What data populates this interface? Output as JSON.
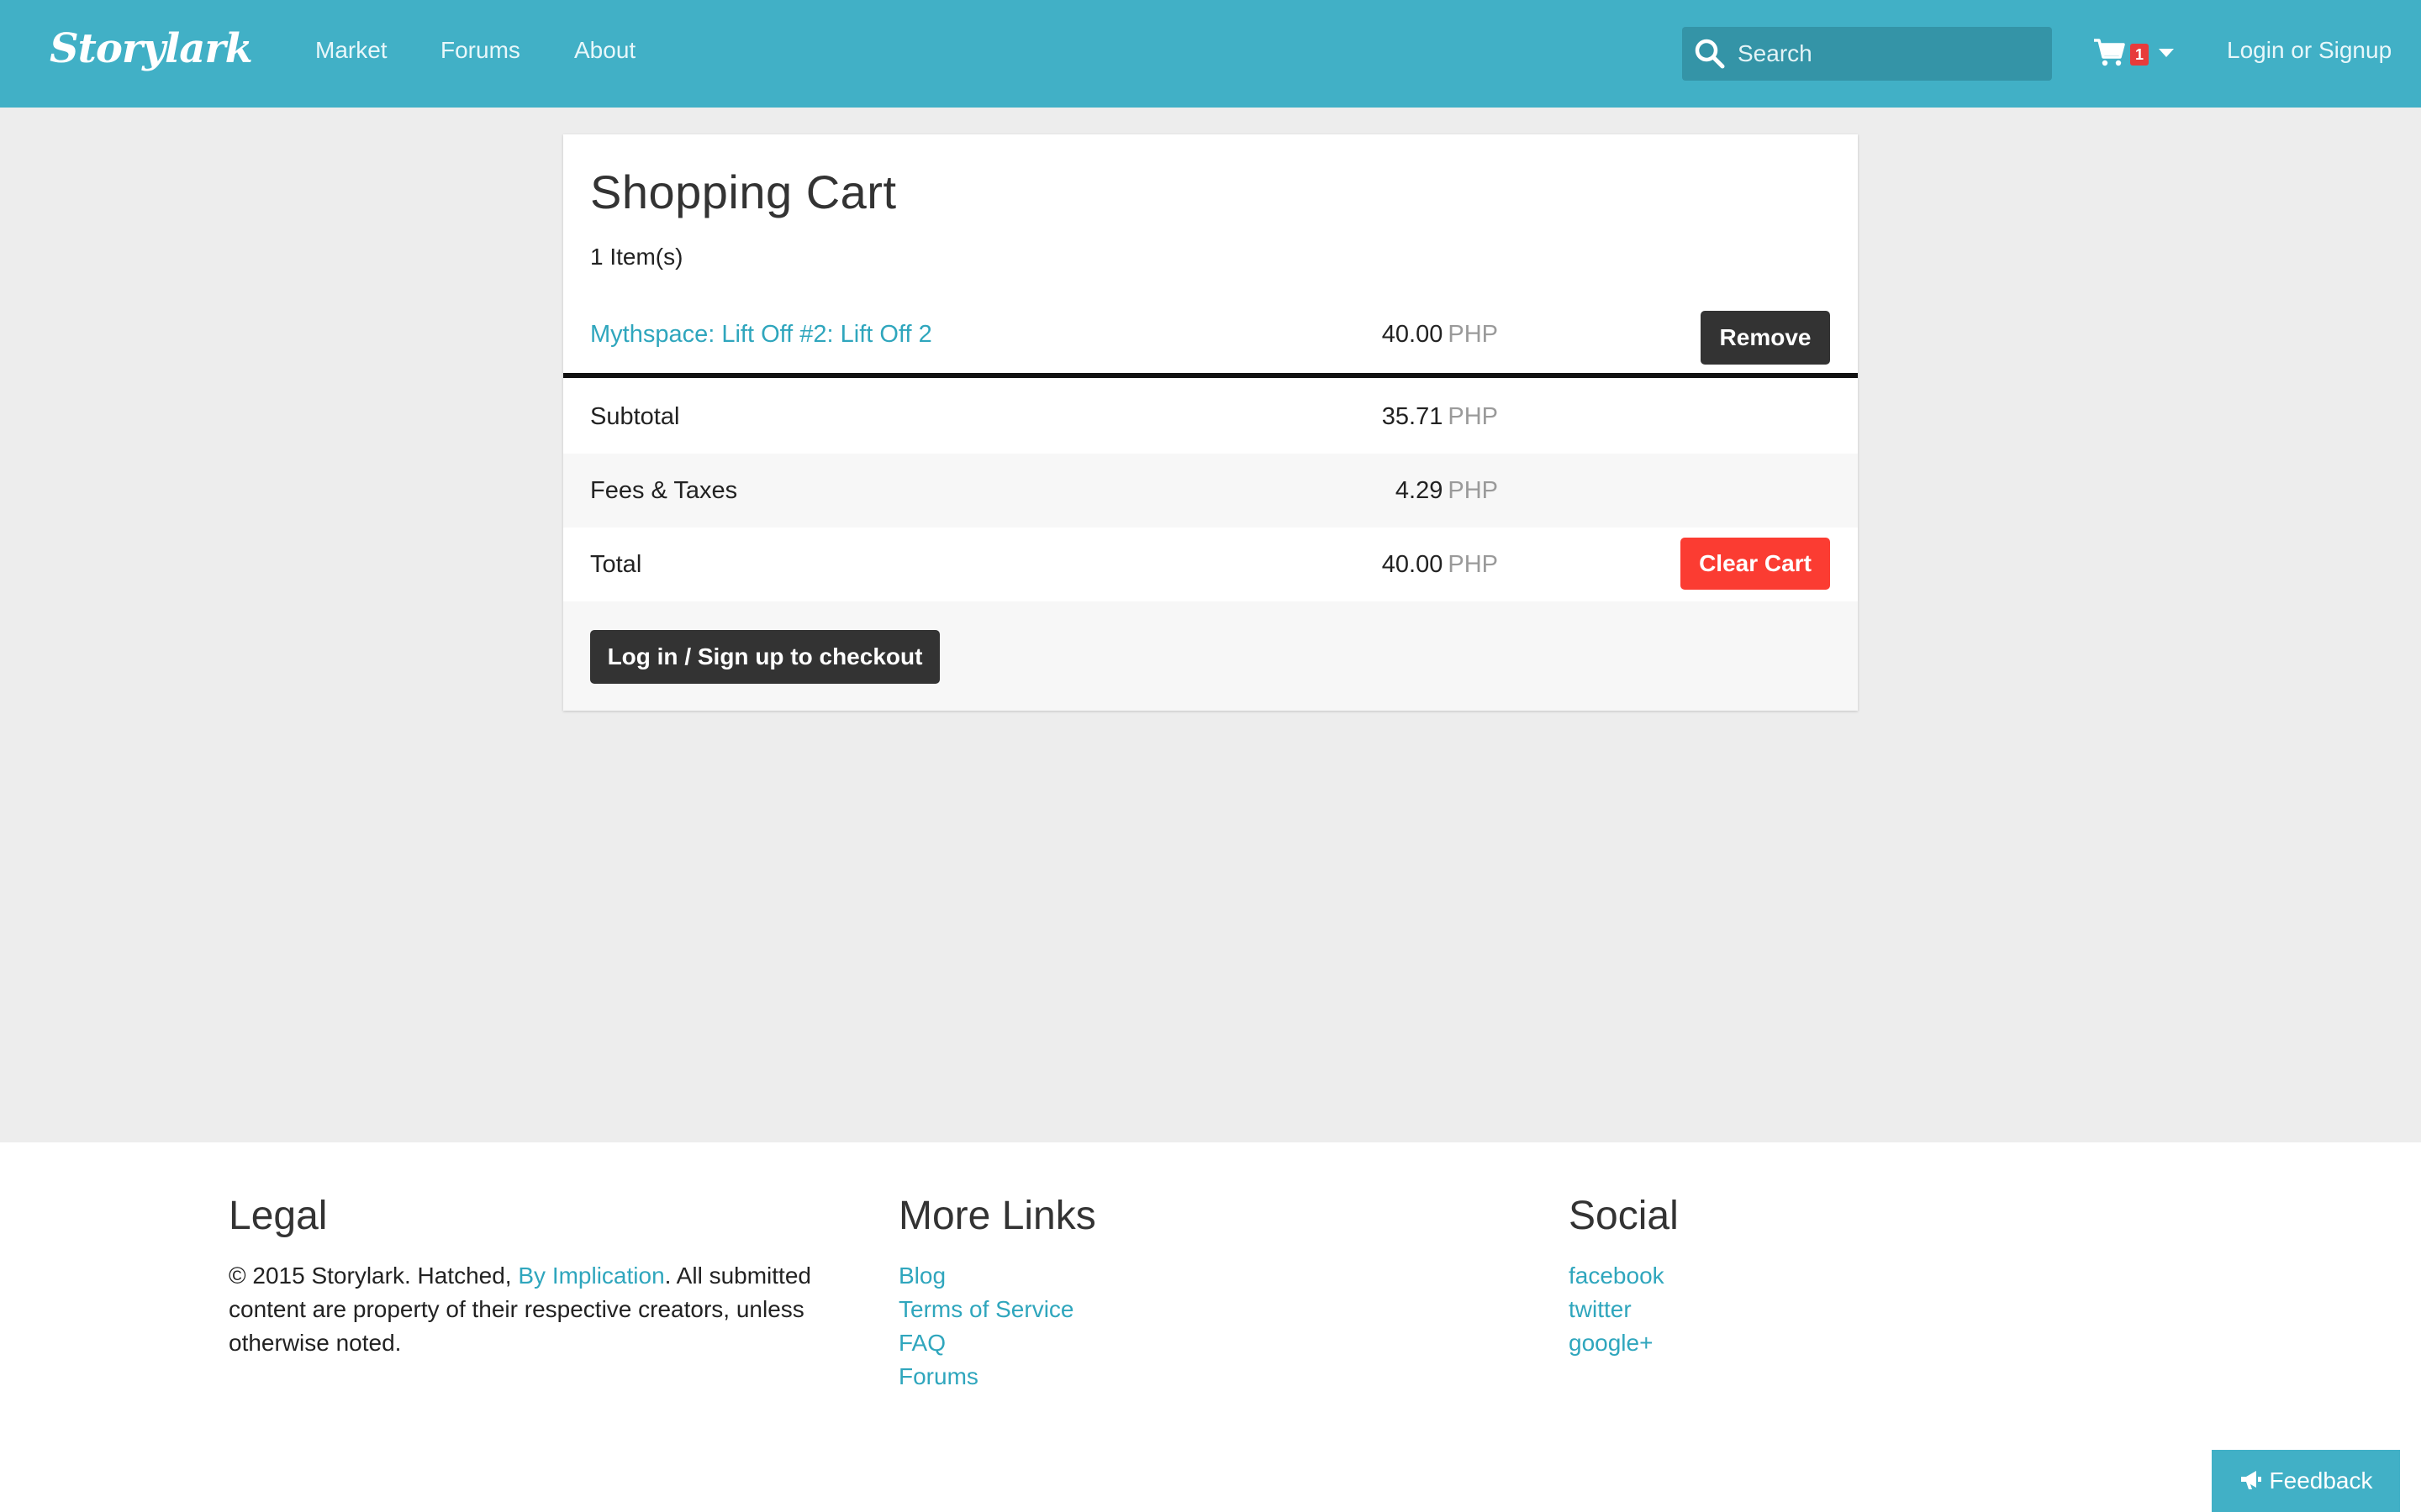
{
  "navbar": {
    "brand": "Storylark",
    "links": [
      "Market",
      "Forums",
      "About"
    ],
    "search_placeholder": "Search",
    "cart_count": "1",
    "login_label": "Login or Signup",
    "icons": {
      "search": "search-icon",
      "cart": "cart-icon",
      "caret": "caret-down-icon"
    }
  },
  "cart": {
    "title": "Shopping Cart",
    "item_count": "1 Item(s)",
    "items": [
      {
        "name": "Mythspace: Lift Off #2: Lift Off 2",
        "price": "40.00",
        "currency": "PHP",
        "remove_label": "Remove"
      }
    ],
    "summary": {
      "subtotal_label": "Subtotal",
      "subtotal": "35.71",
      "fees_label": "Fees & Taxes",
      "fees": "4.29",
      "total_label": "Total",
      "total": "40.00",
      "currency": "PHP"
    },
    "clear_label": "Clear Cart",
    "checkout_label": "Log in / Sign up to checkout"
  },
  "footer": {
    "legal": {
      "heading": "Legal",
      "text_before": "© 2015 Storylark. Hatched, ",
      "link": "By Implication",
      "text_after": ". All submitted content are property of their respective creators, unless otherwise noted."
    },
    "more_links": {
      "heading": "More Links",
      "items": [
        "Blog",
        "Terms of Service",
        "FAQ",
        "Forums"
      ]
    },
    "social": {
      "heading": "Social",
      "items": [
        "facebook",
        "twitter",
        "google+"
      ]
    },
    "feedback_label": "Feedback"
  },
  "colors": {
    "brand": "#41b0c6",
    "link": "#2fa6bd",
    "danger": "#fb3c32",
    "dark_button": "#333333"
  }
}
